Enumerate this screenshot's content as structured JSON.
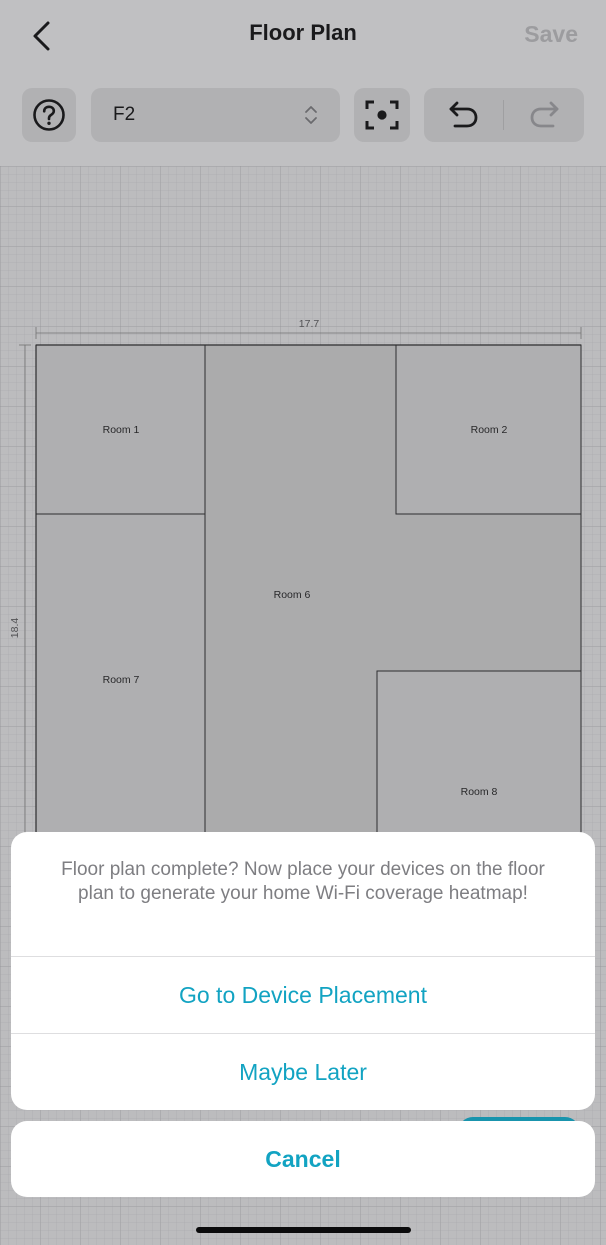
{
  "header": {
    "back_icon": "chevron-left-icon",
    "title": "Floor Plan",
    "save_label": "Save"
  },
  "toolbar": {
    "help_icon": "question-circle-icon",
    "floor_value": "F2",
    "floor_chevrons_icon": "chevron-up-down-icon",
    "focus_icon": "center-focus-icon",
    "undo_icon": "undo-arrow-icon",
    "redo_icon": "redo-arrow-icon"
  },
  "floor_plan": {
    "width_label": "17.7",
    "height_label": "18.4",
    "rooms": {
      "room_1": "Room 1",
      "room_2": "Room 2",
      "room_6": "Room 6",
      "room_7": "Room 7",
      "room_8": "Room 8"
    }
  },
  "action_sheet": {
    "message": "Floor plan complete? Now place your devices on the floor plan to generate your home Wi-Fi coverage heatmap!",
    "primary_action": "Go to Device Placement",
    "secondary_action": "Maybe Later",
    "cancel": "Cancel"
  },
  "colors": {
    "accent": "#12a3c2",
    "message_text": "#7e7e82",
    "room_fill": "#b4b4b6",
    "wall_line": "#2f2f31",
    "canvas_bg": "#c4c4c6"
  }
}
